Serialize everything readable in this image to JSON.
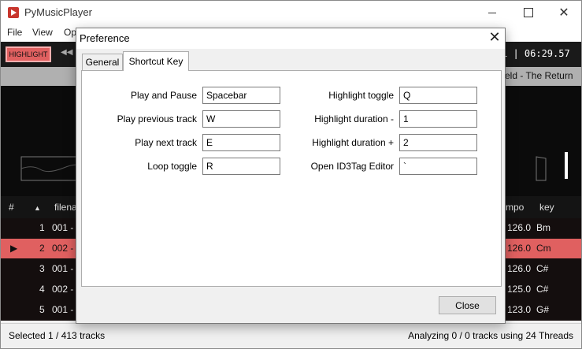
{
  "app": {
    "title": "PyMusicPlayer"
  },
  "menu": {
    "file": "File",
    "view": "View",
    "options": "Op"
  },
  "toolbar": {
    "highlight_label": "HIGHLIGHT",
    "time_display": "1 | 06:29.57"
  },
  "now_playing": {
    "text": "eld - The Return"
  },
  "table": {
    "headers": {
      "num": "#",
      "sort": "▲",
      "filename": "filena",
      "tempo": "mpo",
      "key": "key"
    },
    "rows": [
      {
        "indicator": "",
        "num": "1",
        "filename": "001 -",
        "tempo": "126.0",
        "key": "Bm",
        "selected": false
      },
      {
        "indicator": "▶",
        "num": "2",
        "filename": "002 -",
        "tempo": "126.0",
        "key": "Cm",
        "selected": true
      },
      {
        "indicator": "",
        "num": "3",
        "filename": "001 -",
        "tempo": "126.0",
        "key": "C#",
        "selected": false
      },
      {
        "indicator": "",
        "num": "4",
        "filename": "002 -",
        "tempo": "125.0",
        "key": "C#",
        "selected": false
      },
      {
        "indicator": "",
        "num": "5",
        "filename": "001 -",
        "tempo": "123.0",
        "key": "G#",
        "selected": false
      }
    ]
  },
  "status": {
    "left": "Selected 1 / 413 tracks",
    "right": "Analyzing 0 / 0 tracks using 24 Threads"
  },
  "dialog": {
    "title": "Preference",
    "tabs": {
      "general": "General",
      "shortcut": "Shortcut Key"
    },
    "left_fields": [
      {
        "label": "Play and Pause",
        "value": "Spacebar"
      },
      {
        "label": "Play previous track",
        "value": "W"
      },
      {
        "label": "Play next track",
        "value": "E"
      },
      {
        "label": "Loop toggle",
        "value": "R"
      }
    ],
    "right_fields": [
      {
        "label": "Highlight toggle",
        "value": "Q"
      },
      {
        "label": "Highlight duration -",
        "value": "1"
      },
      {
        "label": "Highlight duration +",
        "value": "2"
      },
      {
        "label": "Open ID3Tag Editor",
        "value": "`"
      }
    ],
    "close_label": "Close"
  },
  "colors": {
    "accent": "#e06060",
    "dark_bg": "#0b0b0b"
  }
}
